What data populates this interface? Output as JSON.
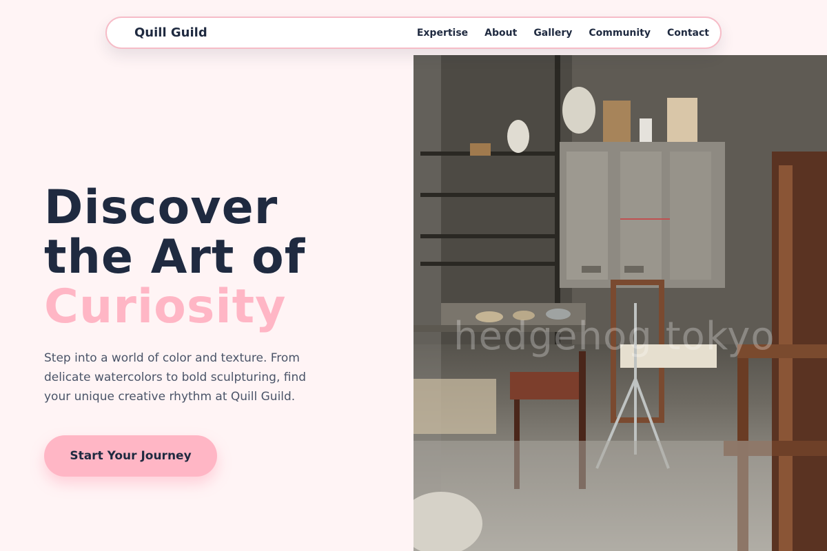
{
  "nav": {
    "brand": "Quill Guild",
    "links": [
      "Expertise",
      "About",
      "Gallery",
      "Community",
      "Contact"
    ]
  },
  "hero": {
    "headline_line1": "Discover",
    "headline_line2": "the Art of",
    "headline_accent": "Curiosity",
    "description": "Step into a world of color and texture. From delicate watercolors to bold sculpturing, find your unique creative rhythm at Quill Guild.",
    "cta_label": "Start Your Journey"
  },
  "image": {
    "subject": "art-studio-photo",
    "watermark": "hedgehog tokyo"
  },
  "colors": {
    "background": "#fff4f5",
    "accent": "#ffb6c5",
    "text_dark": "#1f2a40",
    "text_muted": "#4a5468",
    "nav_border": "#f6bcc7"
  }
}
